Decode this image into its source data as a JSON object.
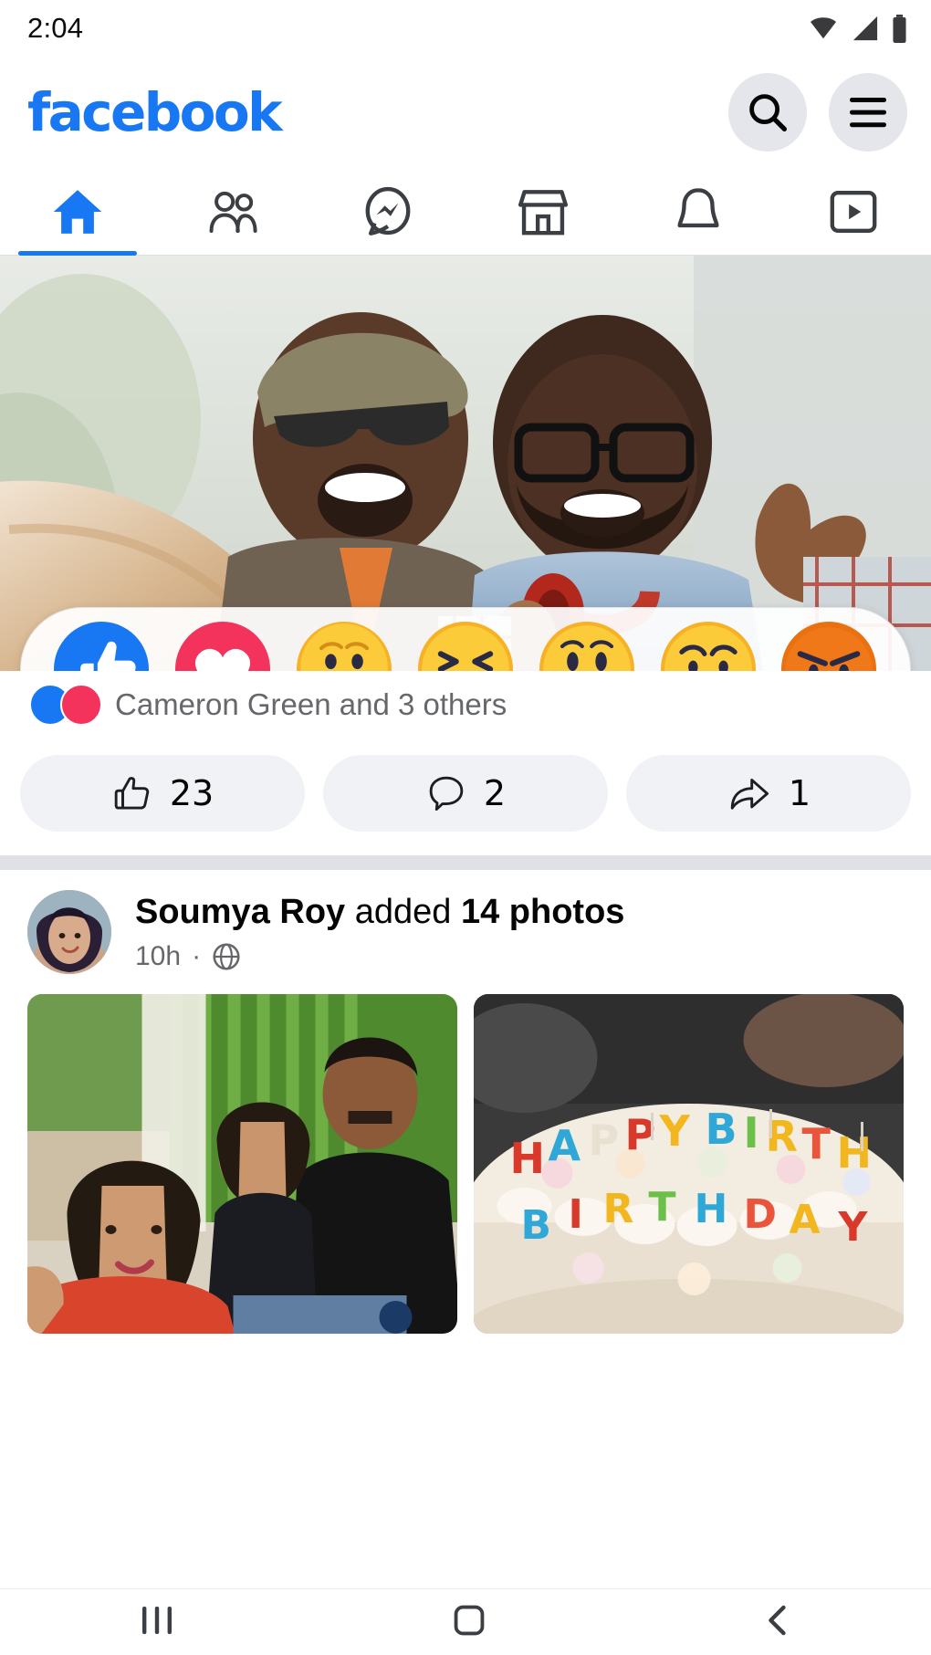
{
  "status_bar": {
    "time": "2:04",
    "icons": [
      "wifi-icon",
      "cellular-signal-icon",
      "battery-icon"
    ]
  },
  "header": {
    "logo_text": "facebook",
    "brand_color": "#1877F2",
    "search_icon": "search-icon",
    "menu_icon": "hamburger-menu-icon"
  },
  "tabs": [
    {
      "name": "home",
      "icon": "home-icon",
      "active": true
    },
    {
      "name": "friends",
      "icon": "friends-icon",
      "active": false
    },
    {
      "name": "messenger",
      "icon": "messenger-icon",
      "active": false
    },
    {
      "name": "marketplace",
      "icon": "marketplace-icon",
      "active": false
    },
    {
      "name": "notifications",
      "icon": "bell-icon",
      "active": false
    },
    {
      "name": "watch",
      "icon": "watch-video-icon",
      "active": false
    }
  ],
  "post_1": {
    "image_alt": "two-friends-selfie-photo",
    "reactions_popup": {
      "visible": true,
      "options": [
        {
          "name": "like",
          "emoji": "👍",
          "color": "#1877F2"
        },
        {
          "name": "love",
          "emoji": "❤",
          "color": "#F3335B"
        },
        {
          "name": "care",
          "emoji": "🥰",
          "color": "#F7B125"
        },
        {
          "name": "haha",
          "emoji": "😆",
          "color": "#F7B125"
        },
        {
          "name": "wow",
          "emoji": "😮",
          "color": "#F7B125"
        },
        {
          "name": "sad",
          "emoji": "😢",
          "color": "#F7B125"
        },
        {
          "name": "angry",
          "emoji": "😡",
          "color": "#E9710F"
        }
      ]
    },
    "likers_text": "Cameron Green and 3 others",
    "actions": [
      {
        "name": "like",
        "icon": "thumbs-up-outline-icon",
        "count": "23"
      },
      {
        "name": "comment",
        "icon": "comment-bubble-icon",
        "count": "2"
      },
      {
        "name": "share",
        "icon": "share-arrow-icon",
        "count": "1"
      }
    ]
  },
  "post_2": {
    "author": "Soumya Roy",
    "action_text": "added",
    "object_text": "14 photos",
    "timestamp": "10h",
    "separator": "·",
    "privacy_icon": "globe-public-icon",
    "avatar_alt": "soumya-roy-avatar",
    "photos": [
      {
        "alt": "three-friends-group-photo"
      },
      {
        "alt": "happy-birthday-cake-photo"
      }
    ]
  },
  "android_nav": {
    "recents_icon": "recent-apps-icon",
    "home_icon": "home-square-icon",
    "back_icon": "back-chevron-icon"
  }
}
